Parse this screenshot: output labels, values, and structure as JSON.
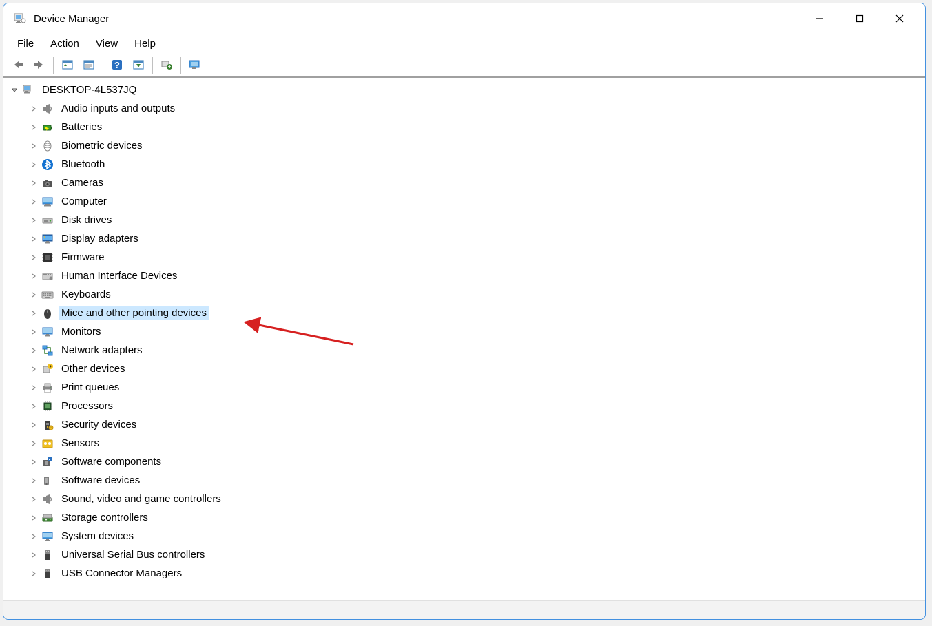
{
  "window": {
    "title": "Device Manager"
  },
  "menubar": {
    "items": [
      {
        "label": "File"
      },
      {
        "label": "Action"
      },
      {
        "label": "View"
      },
      {
        "label": "Help"
      }
    ]
  },
  "toolbar": {
    "back": "Back",
    "forward": "Forward",
    "properties": "Properties",
    "update": "Update",
    "help": "Help",
    "scan": "Scan for hardware changes",
    "add": "Add legacy hardware",
    "monitor": "Devices and Printers"
  },
  "tree": {
    "root": {
      "label": "DESKTOP-4L537JQ",
      "icon": "computer-root-icon",
      "expanded": true
    },
    "categories": [
      {
        "label": "Audio inputs and outputs",
        "icon": "audio-icon"
      },
      {
        "label": "Batteries",
        "icon": "battery-icon"
      },
      {
        "label": "Biometric devices",
        "icon": "biometric-icon"
      },
      {
        "label": "Bluetooth",
        "icon": "bluetooth-icon"
      },
      {
        "label": "Cameras",
        "icon": "camera-icon"
      },
      {
        "label": "Computer",
        "icon": "computer-icon"
      },
      {
        "label": "Disk drives",
        "icon": "disk-icon"
      },
      {
        "label": "Display adapters",
        "icon": "display-icon"
      },
      {
        "label": "Firmware",
        "icon": "firmware-icon"
      },
      {
        "label": "Human Interface Devices",
        "icon": "hid-icon"
      },
      {
        "label": "Keyboards",
        "icon": "keyboard-icon"
      },
      {
        "label": "Mice and other pointing devices",
        "icon": "mouse-icon",
        "selected": true
      },
      {
        "label": "Monitors",
        "icon": "monitor-icon"
      },
      {
        "label": "Network adapters",
        "icon": "network-icon"
      },
      {
        "label": "Other devices",
        "icon": "other-icon"
      },
      {
        "label": "Print queues",
        "icon": "printer-icon"
      },
      {
        "label": "Processors",
        "icon": "processor-icon"
      },
      {
        "label": "Security devices",
        "icon": "security-icon"
      },
      {
        "label": "Sensors",
        "icon": "sensor-icon"
      },
      {
        "label": "Software components",
        "icon": "software-comp-icon"
      },
      {
        "label": "Software devices",
        "icon": "software-dev-icon"
      },
      {
        "label": "Sound, video and game controllers",
        "icon": "sound-icon"
      },
      {
        "label": "Storage controllers",
        "icon": "storage-icon"
      },
      {
        "label": "System devices",
        "icon": "system-icon"
      },
      {
        "label": "Universal Serial Bus controllers",
        "icon": "usb-icon"
      },
      {
        "label": "USB Connector Managers",
        "icon": "usb-connector-icon"
      }
    ]
  },
  "annotation": {
    "arrow_target": "Mice and other pointing devices"
  }
}
